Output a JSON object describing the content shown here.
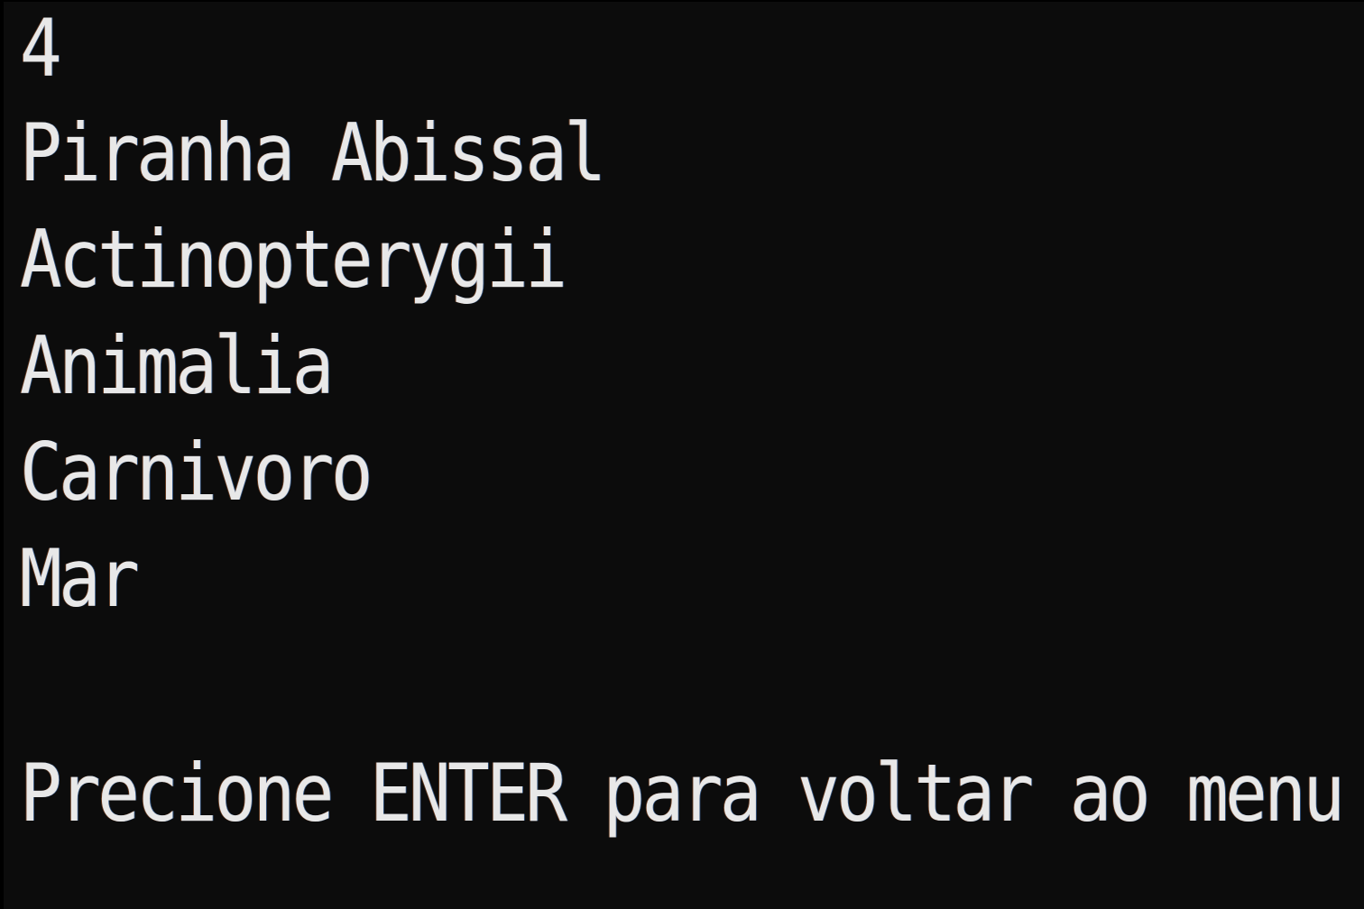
{
  "console": {
    "lines": [
      "4",
      "Piranha Abissal",
      "Actinopterygii",
      "Animalia",
      "Carnivoro",
      "Mar"
    ],
    "prompt": "Precione ENTER para voltar ao menu"
  },
  "colors": {
    "background": "#0c0c0c",
    "text": "#e8e8e8"
  }
}
